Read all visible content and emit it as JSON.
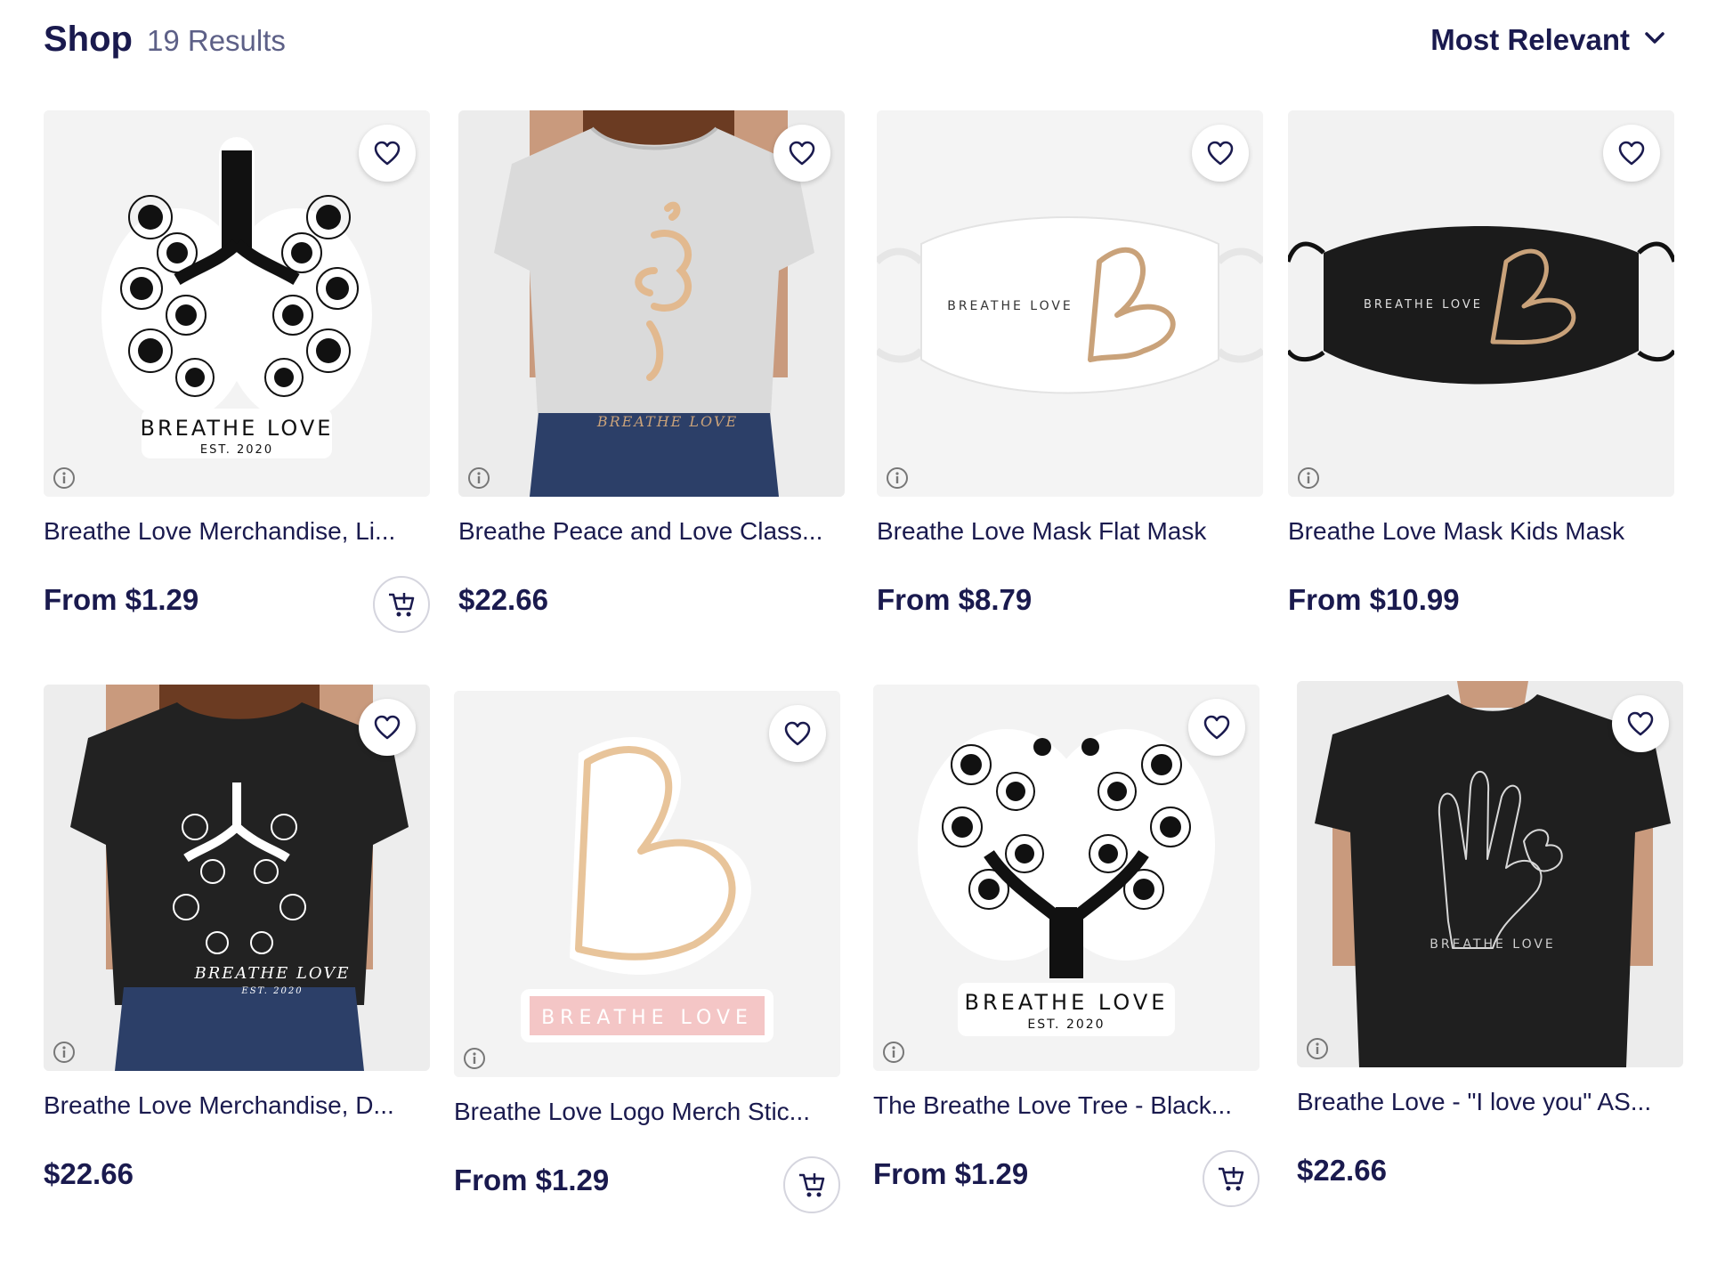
{
  "header": {
    "title": "Shop",
    "result_count": "19 Results",
    "sort_label": "Most Relevant"
  },
  "products": [
    {
      "title": "Breathe Love Merchandise, Li...",
      "price": "From $1.29",
      "art": "lungs-sticker",
      "art_text": "BREATHE LOVE",
      "art_sub": "EST. 2020",
      "has_cart": true
    },
    {
      "title": "Breathe Peace and Love Class...",
      "price": "$22.66",
      "art": "white-tee",
      "art_text": "BREATHE LOVE",
      "has_cart": false
    },
    {
      "title": "Breathe Love Mask Flat Mask",
      "price": "From $8.79",
      "art": "white-mask",
      "art_text": "BREATHE LOVE",
      "has_cart": false
    },
    {
      "title": "Breathe Love Mask Kids Mask",
      "price": "From $10.99",
      "art": "black-mask",
      "art_text": "BREATHE LOVE",
      "has_cart": false
    },
    {
      "title": "Breathe Love Merchandise, D...",
      "price": "$22.66",
      "art": "black-tee-lungs",
      "art_text": "BREATHE LOVE",
      "art_sub": "EST. 2020",
      "has_cart": false
    },
    {
      "title": "Breathe Love Logo Merch Stic...",
      "price": "From $1.29",
      "art": "logo-sticker",
      "art_text": "BREATHE LOVE",
      "has_cart": true
    },
    {
      "title": "The Breathe Love Tree - Black...",
      "price": "From $1.29",
      "art": "tree-sticker",
      "art_text": "BREATHE LOVE",
      "art_sub": "EST. 2020",
      "has_cart": true
    },
    {
      "title": "Breathe Love - \"I love you\" AS...",
      "price": "$22.66",
      "art": "black-tee-hand",
      "art_text": "BREATHE LOVE",
      "has_cart": false
    }
  ],
  "colors": {
    "navy": "#1a1a4e",
    "muted": "#5d6087",
    "gold": "#c9a27a",
    "pink": "#f4c6c6"
  }
}
